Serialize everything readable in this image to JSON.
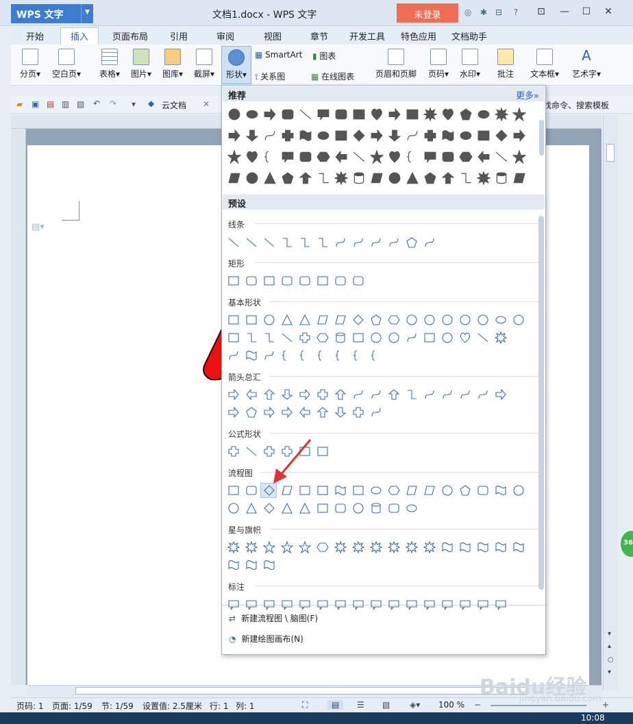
{
  "app": {
    "name": "WPS 文字",
    "doc_title": "文档1.docx - WPS 文字",
    "login": "未登录"
  },
  "menu_tabs": [
    "开始",
    "插入",
    "页面布局",
    "引用",
    "审阅",
    "视图",
    "章节",
    "开发工具",
    "特色应用",
    "文档助手"
  ],
  "ribbon": {
    "fenye": "分页",
    "kongbaiye": "空白页",
    "biaoge": "表格",
    "tupian": "图片",
    "tuku": "图库",
    "jieping": "截屏",
    "xingzhuang": "形状",
    "smartart": "SmartArt",
    "tubiao": "图表",
    "guanxitu": "关系图",
    "zaixiantubiao": "在线图表",
    "yemei": "页眉和页脚",
    "yema": "页码",
    "shuiyin": "水印",
    "pizhu": "批注",
    "wenbenkuang": "文本框",
    "yishuzi": "艺术字"
  },
  "qat": {
    "yunwendang": "云文档",
    "search_hint": "找命令、搜索模板"
  },
  "popup": {
    "recommend": "推荐",
    "more": "更多»",
    "preset": "预设",
    "categories": {
      "lines": "线条",
      "rect": "矩形",
      "basic": "基本形状",
      "arrows": "箭头总汇",
      "formula": "公式形状",
      "flowchart": "流程图",
      "stars": "星与旗帜",
      "callout": "标注"
    },
    "new_flowchart": "新建流程图 \\ 脑图(F)",
    "new_canvas": "新建绘图画布(N)"
  },
  "status": {
    "yema": "页码: 1",
    "yemian": "页面: 1/59",
    "jie": "节: 1/59",
    "shezhi": "设置值: 2.5厘米",
    "hang": "行: 1",
    "lie": "列: 1",
    "zoom": "100 %"
  },
  "taskbar": {
    "clock": "10:08"
  },
  "watermark": {
    "brand": "Baidu经验",
    "url": "jingyan.baidu.com"
  },
  "colors": {
    "accent": "#2a67b8",
    "login": "#f06c52",
    "arrow": "#e03030",
    "shape_stroke": "#3e6fa7"
  }
}
